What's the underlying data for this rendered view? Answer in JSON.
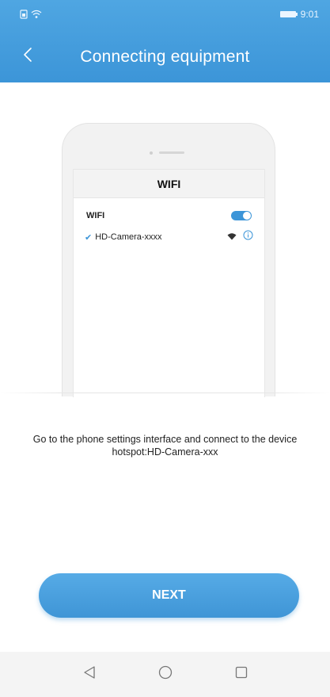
{
  "status_bar": {
    "time": "9:01",
    "icons": [
      "sim-icon",
      "wifi-icon",
      "battery-icon"
    ]
  },
  "header": {
    "title": "Connecting equipment",
    "back_icon": "chevron-left-icon"
  },
  "illustration": {
    "screen_title": "WIFI",
    "wifi_label": "WIFI",
    "wifi_enabled": true,
    "network_name": "HD-Camera-xxxx",
    "network_icons": [
      "wifi-signal-icon",
      "info-icon"
    ]
  },
  "instruction": {
    "text": "Go to the phone settings interface and connect to the device hotspot:HD-Camera-xxx"
  },
  "actions": {
    "next_label": "NEXT"
  },
  "nav_bar": {
    "icons": [
      "back-triangle-icon",
      "home-circle-icon",
      "recents-square-icon"
    ]
  },
  "colors": {
    "accent": "#3c95d8",
    "header_top": "#4fa6e2"
  }
}
